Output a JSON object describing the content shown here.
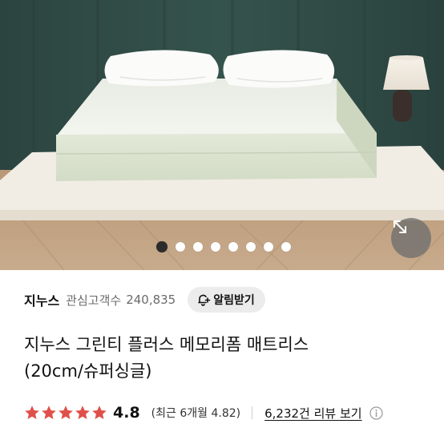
{
  "gallery": {
    "total_images": 8,
    "active_index": 0
  },
  "brand": {
    "name": "지누스",
    "fav_label": "관심고객수",
    "fav_count": "240,835",
    "alarm_label": "알림받기"
  },
  "product": {
    "title_line1": "지누스 그린티 플러스 메모리폼 매트리스",
    "title_line2": "(20cm/슈퍼싱글)"
  },
  "rating": {
    "stars": 5,
    "value": "4.8",
    "recent": "(최근 6개월 4.82)",
    "reviews_link": "6,232건 리뷰 보기"
  },
  "colors": {
    "star": "#e0504a",
    "active_dot": "#2b2b2b"
  }
}
